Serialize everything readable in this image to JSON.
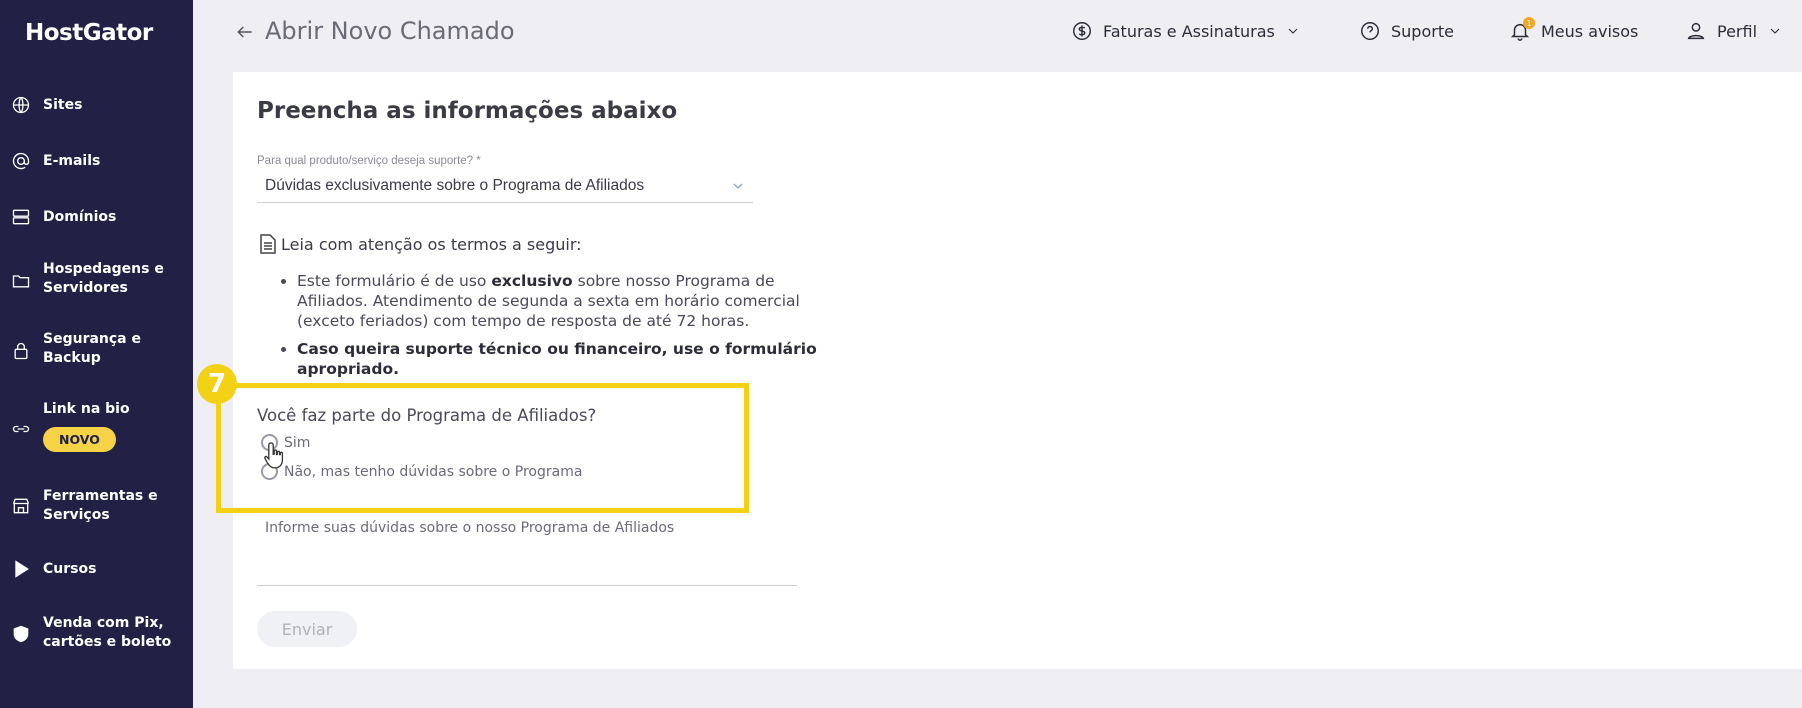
{
  "sidebar": {
    "logo": "HostGator",
    "items": [
      {
        "label": "Sites",
        "icon": "globe-icon"
      },
      {
        "label": "E-mails",
        "icon": "at-icon"
      },
      {
        "label": "Domínios",
        "icon": "server-icon"
      },
      {
        "label": "Hospedagens e Servidores",
        "icon": "folder-icon"
      },
      {
        "label": "Segurança e Backup",
        "icon": "lock-icon"
      },
      {
        "label": "Link na bio",
        "icon": "link-icon",
        "badge": "NOVO"
      },
      {
        "label": "Ferramentas e Serviços",
        "icon": "store-icon"
      },
      {
        "label": "Cursos",
        "icon": "play-icon"
      },
      {
        "label": "Venda com Pix, cartões e boleto",
        "icon": "shield-icon"
      }
    ]
  },
  "header": {
    "title": "Abrir Novo Chamado",
    "billing": "Faturas e Assinaturas",
    "support": "Suporte",
    "notifications": "Meus avisos",
    "notification_count": "1",
    "profile": "Perfil"
  },
  "form": {
    "heading": "Preencha as informações abaixo",
    "product_label": "Para qual produto/serviço deseja suporte? *",
    "product_value": "Dúvidas exclusivamente sobre o Programa de Afiliados",
    "terms_title": "Leia com atenção os termos a seguir:",
    "term1_a": "Este formulário é de uso ",
    "term1_b": "exclusivo",
    "term1_c": " sobre nosso Programa de Afiliados. Atendimento de segunda a sexta em horário comercial (exceto feriados) com tempo de resposta de até 72 horas.",
    "term2": "Caso queira suporte técnico ou financeiro, use o formulário apropriado.",
    "question": "Você faz parte do Programa de Afiliados?",
    "option_yes": "Sim",
    "option_no": "Não, mas tenho dúvidas sobre o Programa",
    "textarea_placeholder": "Informe suas dúvidas sobre o nosso Programa de Afiliados",
    "submit": "Enviar"
  },
  "annotation": {
    "step": "7",
    "color": "#f3d215"
  },
  "colors": {
    "sidebar": "#222145",
    "accent": "#f6d247"
  }
}
